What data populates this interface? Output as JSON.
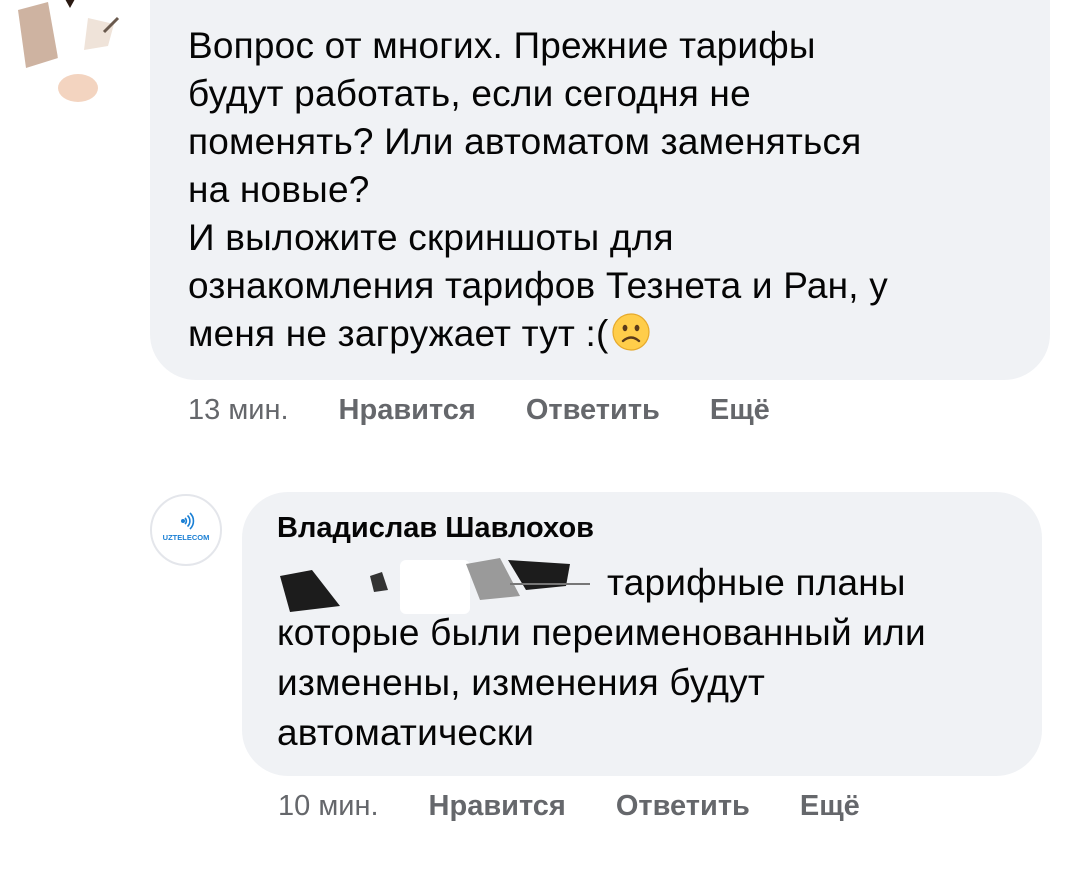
{
  "comment1": {
    "text": "Вопрос от многих. Прежние тарифы\nбудут работать, если сегодня не\nпоменять? Или автоматом заменяться\nна новые?\nИ выложите скриншоты для\nознакомления тарифов Тезнета и Ран, у\nменя не загружает тут :(",
    "emoji": "sad-face",
    "time": "13 мин.",
    "like": "Нравится",
    "reply": "Ответить",
    "more": "Ещё"
  },
  "comment2": {
    "author": "Владислав Шавлохов",
    "avatar_text": "UZTELECOM",
    "text": "тарифные планы которые были переименованный или изменены, изменения будут автоматически",
    "time": "10 мин.",
    "like": "Нравится",
    "reply": "Ответить",
    "more": "Ещё"
  },
  "colors": {
    "bubble": "#f0f2f5",
    "meta_text": "#65676b",
    "text": "#050505",
    "brand": "#1a7fd4"
  }
}
